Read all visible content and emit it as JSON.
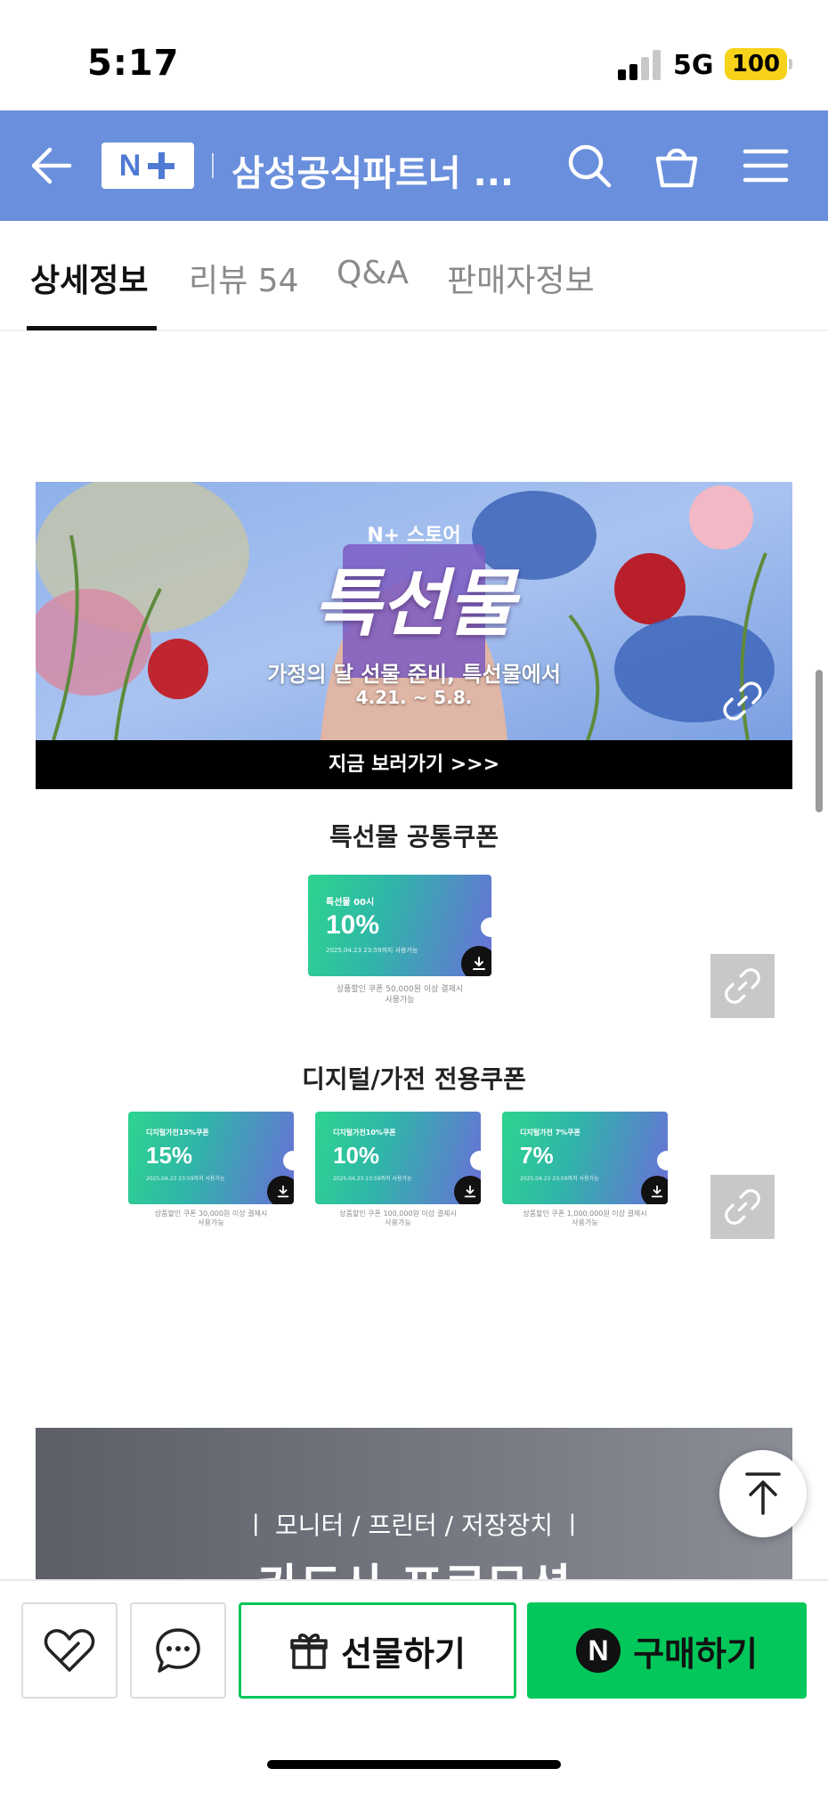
{
  "status_bar": {
    "time": "5:17",
    "network": "5G",
    "battery": "100"
  },
  "header": {
    "logo_n": "N",
    "store_title": "삼성공식파트너 ..."
  },
  "tabs": [
    {
      "label": "상세정보",
      "active": true
    },
    {
      "label": "리뷰 54",
      "active": false
    },
    {
      "label": "Q&A",
      "active": false
    },
    {
      "label": "판매자정보",
      "active": false
    }
  ],
  "promo_banner": {
    "store_badge": "N+ 스토어",
    "title": "특선물",
    "subtitle": "가정의 달 선물 준비, 특선물에서",
    "dates": "4.21. ~ 5.8.",
    "cta": "지금 보러가기 >>>"
  },
  "common_coupon_section": {
    "title": "특선물 공통쿠폰",
    "coupon": {
      "name": "특선물 00시",
      "percent": "10%",
      "valid_until": "2025.04.23 23:59까지 사용가능",
      "note_line1": "상품할인 쿠폰 50,000원 이상 결제시",
      "note_line2": "사용가능"
    }
  },
  "digital_coupon_section": {
    "title": "디지털/가전 전용쿠폰",
    "coupons": [
      {
        "name": "디지털가전15%쿠폰",
        "percent": "15%",
        "valid_until": "2025.04.23 23:59까지 사용가능",
        "note_line1": "상품할인 쿠폰 30,000원 이상 결제시",
        "note_line2": "사용가능"
      },
      {
        "name": "디지털가전10%쿠폰",
        "percent": "10%",
        "valid_until": "2025.04.23 23:59까지 사용가능",
        "note_line1": "상품할인 쿠폰 100,000원 이상 결제시",
        "note_line2": "사용가능"
      },
      {
        "name": "디지털가전 7%쿠폰",
        "percent": "7%",
        "valid_until": "2025.04.23 23:59까지 사용가능",
        "note_line1": "상품할인 쿠폰 1,000,000원 이상 결제시",
        "note_line2": "사용가능"
      }
    ]
  },
  "bottom_banner": {
    "categories": "ㅣ 모니터 / 프린터 / 저장장치 ㅣ",
    "title": "카드사 프로모션"
  },
  "action_bar": {
    "gift_label": "선물하기",
    "buy_label": "구매하기",
    "buy_badge": "N"
  },
  "colors": {
    "header_bg": "#6a8fdc",
    "naver_green": "#03c75a",
    "battery_yellow": "#f7d21a"
  },
  "icons": [
    "back-arrow-icon",
    "search-icon",
    "cart-icon",
    "menu-icon",
    "link-icon",
    "download-icon",
    "heart-icon",
    "chat-icon",
    "gift-icon",
    "scroll-top-icon"
  ]
}
